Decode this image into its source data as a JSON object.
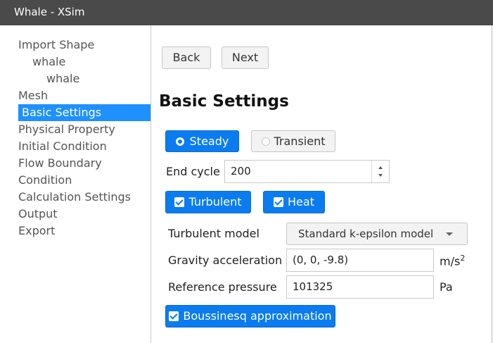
{
  "window": {
    "title": "Whale - XSim"
  },
  "sidebar": {
    "items": [
      {
        "label": "Import Shape"
      },
      {
        "label": "whale"
      },
      {
        "label": "whale"
      },
      {
        "label": "Mesh"
      },
      {
        "label": "Basic Settings",
        "active": true
      },
      {
        "label": "Physical Property"
      },
      {
        "label": "Initial Condition"
      },
      {
        "label": "Flow Boundary"
      },
      {
        "label": "Condition"
      },
      {
        "label": "Calculation Settings"
      },
      {
        "label": "Output"
      },
      {
        "label": "Export"
      }
    ]
  },
  "nav": {
    "back_label": "Back",
    "next_label": "Next"
  },
  "main": {
    "title": "Basic Settings",
    "mode": {
      "steady_label": "Steady",
      "transient_label": "Transient",
      "selected": "Steady"
    },
    "end_cycle": {
      "label": "End cycle",
      "value": "200"
    },
    "turbulent": {
      "label": "Turbulent",
      "checked": true
    },
    "heat": {
      "label": "Heat",
      "checked": true
    },
    "turbulent_model": {
      "label": "Turbulent model",
      "value": "Standard k-epsilon model"
    },
    "gravity": {
      "label": "Gravity acceleration",
      "value": "(0, 0, -9.8)",
      "unit": "m/s",
      "unit_sup": "2"
    },
    "ref_pressure": {
      "label": "Reference pressure",
      "value": "101325",
      "unit": "Pa"
    },
    "boussinesq": {
      "label": "Boussinesq approximation",
      "checked": true
    }
  },
  "colors": {
    "accent": "#0a7cf0",
    "selection": "#1e90ff",
    "titlebar": "#4a4a4a"
  },
  "icons": [
    "checkbox-checked-icon",
    "radio-selected-icon",
    "radio-unselected-icon",
    "spinner-up-icon",
    "spinner-down-icon",
    "dropdown-caret-icon"
  ]
}
